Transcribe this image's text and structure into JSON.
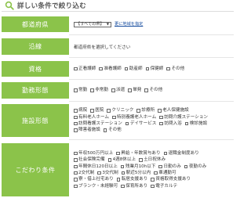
{
  "header": {
    "title": "詳しい条件で絞り込む",
    "icon": "search-icon"
  },
  "prefecture": {
    "label": "都道府県",
    "select_value": "【すべての県】",
    "region_link": "更に地域を指定"
  },
  "route": {
    "label": "沿線",
    "note": "都道府県を選択してください"
  },
  "qualification": {
    "label": "資格",
    "options": [
      "正看護師",
      "准看護師",
      "助産師",
      "保健師",
      "その他"
    ]
  },
  "employment": {
    "label": "勤務形態",
    "options": [
      "常勤",
      "非常勤",
      "派遣",
      "単発",
      "その他"
    ]
  },
  "facility": {
    "label": "施設形態",
    "options": [
      "病院",
      "医院",
      "クリニック",
      "診療所",
      "老人保健施設",
      "有料老人ホーム",
      "特別養護老人ホーム",
      "訪問介護ステーション",
      "訪問看護ステーション",
      "デイサービス",
      "訪問入浴",
      "検診施設",
      "障害者施設",
      "その他"
    ]
  },
  "conditions": {
    "label": "こだわり条件",
    "options": [
      "年収500万円以上",
      "昇給・年数賞与あり",
      "退職金制度あり",
      "社会保険完備",
      "4週8休以上",
      "土日祝休み",
      "年間休日120日以上",
      "残業月10h以下",
      "日勤のみ",
      "夜勤のみ",
      "2交代制",
      "3交代制",
      "駅近5分以内",
      "車通勤可",
      "寮・借上社宅あり",
      "転居支援あり",
      "資格取得支援あり",
      "ブランク・未経験可",
      "保育所あり",
      "電子カルテ"
    ]
  },
  "colors": {
    "label_bg": "#8bc34a",
    "label_text": "#ffffff",
    "link": "#1a4fa0"
  }
}
